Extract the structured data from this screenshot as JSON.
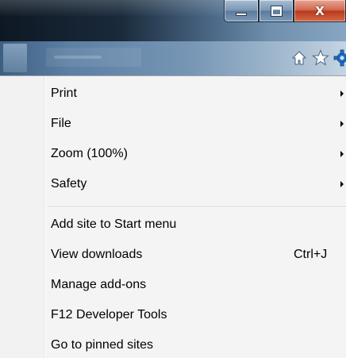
{
  "window": {
    "caption_buttons": [
      {
        "name": "minimize",
        "icon": "minimize-icon"
      },
      {
        "name": "maximize",
        "icon": "maximize-icon"
      },
      {
        "name": "close",
        "icon": "close-icon",
        "glyph": "X"
      }
    ]
  },
  "toolbar": {
    "icons": [
      "home-icon",
      "favorites-star-icon",
      "tools-gear-icon"
    ]
  },
  "menu": {
    "groups": [
      {
        "items": [
          {
            "label": "Print",
            "submenu": true
          },
          {
            "label": "File",
            "submenu": true
          },
          {
            "label": "Zoom (100%)",
            "submenu": true
          },
          {
            "label": "Safety",
            "submenu": true
          }
        ]
      },
      {
        "items": [
          {
            "label": "Add site to Start menu"
          },
          {
            "label": "View downloads",
            "shortcut": "Ctrl+J"
          },
          {
            "label": "Manage add-ons"
          },
          {
            "label": "F12 Developer Tools"
          },
          {
            "label": "Go to pinned sites"
          }
        ]
      }
    ]
  },
  "colors": {
    "titlebar": "#1a2a3b",
    "toolbar": "#7796b5",
    "menu_background": "#f4f4f4",
    "close_button": "#c94a2d",
    "menu_text": "#000000"
  }
}
